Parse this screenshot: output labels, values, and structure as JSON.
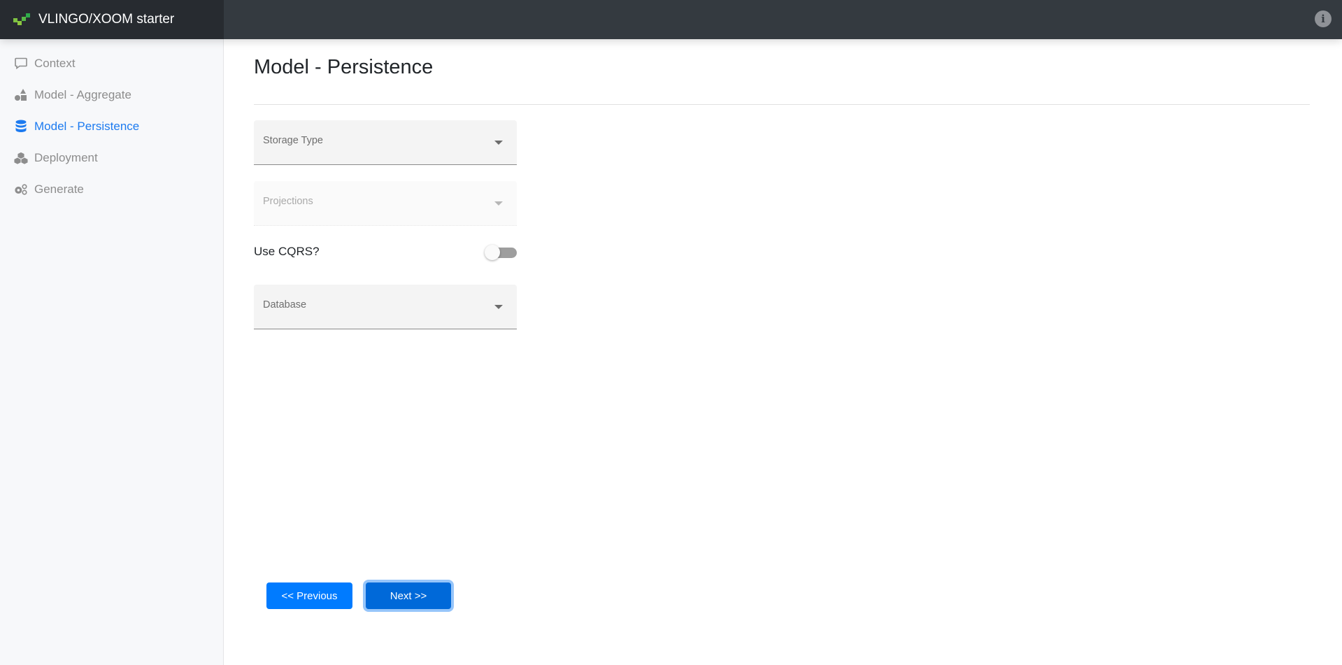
{
  "app": {
    "title": "VLINGO/XOOM starter"
  },
  "header": {
    "info_icon": "info-circle-icon"
  },
  "sidebar": {
    "items": [
      {
        "label": "Context",
        "icon": "comment-icon",
        "active": false
      },
      {
        "label": "Model - Aggregate",
        "icon": "shapes-icon",
        "active": false
      },
      {
        "label": "Model - Persistence",
        "icon": "database-icon",
        "active": true
      },
      {
        "label": "Deployment",
        "icon": "cubes-icon",
        "active": false
      },
      {
        "label": "Generate",
        "icon": "cogs-icon",
        "active": false
      }
    ]
  },
  "main": {
    "title": "Model - Persistence",
    "storage_type": {
      "label": "Storage Type",
      "value": ""
    },
    "projections": {
      "label": "Projections",
      "value": "",
      "disabled": true
    },
    "cqrs": {
      "label": "Use CQRS?",
      "checked": false
    },
    "database": {
      "label": "Database",
      "value": ""
    },
    "buttons": {
      "previous": "<< Previous",
      "next": "Next >>"
    }
  },
  "colors": {
    "accent": "#007bff",
    "active_nav": "#1d7bf0",
    "topbar": "#343a40",
    "brand_bg": "#272b30"
  }
}
